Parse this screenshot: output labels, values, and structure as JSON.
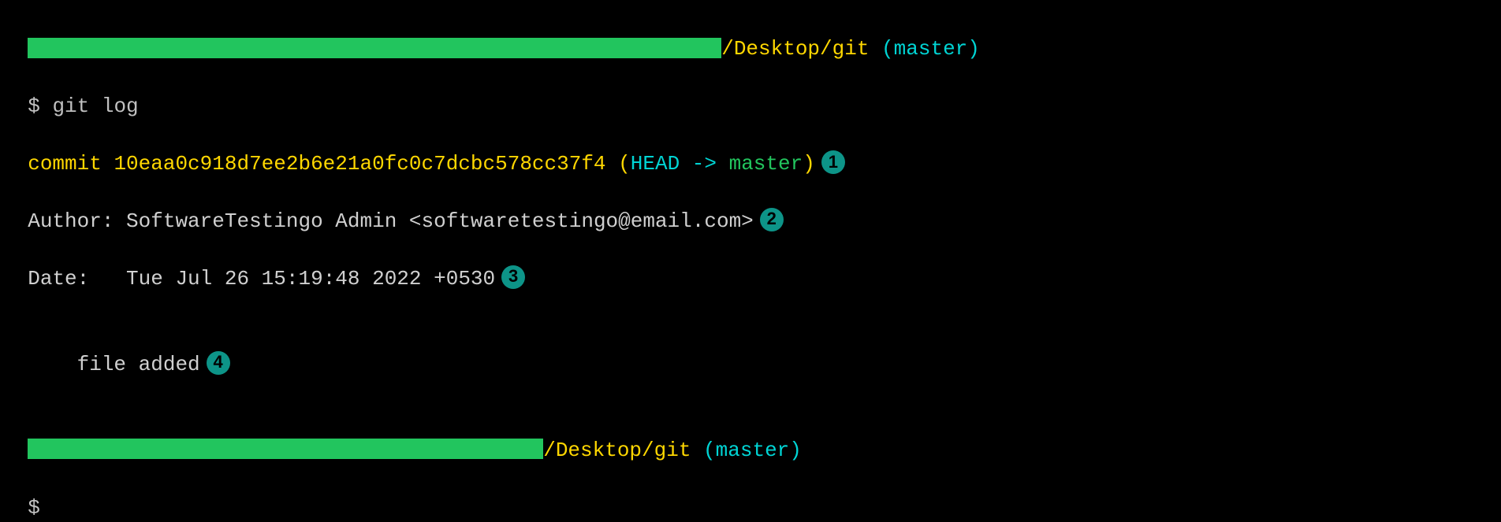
{
  "prompt1": {
    "path": "/Desktop/git",
    "branch": "master"
  },
  "command": "git log",
  "commit": {
    "prefix": "commit ",
    "hash": "10eaa0c918d7ee2b6e21a0fc0c7dcbc578cc37f4",
    "ref_open": " (",
    "head": "HEAD -> ",
    "branch": "master",
    "ref_close": ")"
  },
  "author": {
    "label": "Author: ",
    "value": "SoftwareTestingo Admin <softwaretestingo@email.com>"
  },
  "date": {
    "label": "Date:   ",
    "value": "Tue Jul 26 15:19:48 2022 +0530"
  },
  "message": "    file added",
  "prompt2": {
    "path": "/Desktop/git",
    "branch": "master"
  },
  "prompt_symbol": "$",
  "badges": {
    "b1": "1",
    "b2": "2",
    "b3": "3",
    "b4": "4"
  }
}
